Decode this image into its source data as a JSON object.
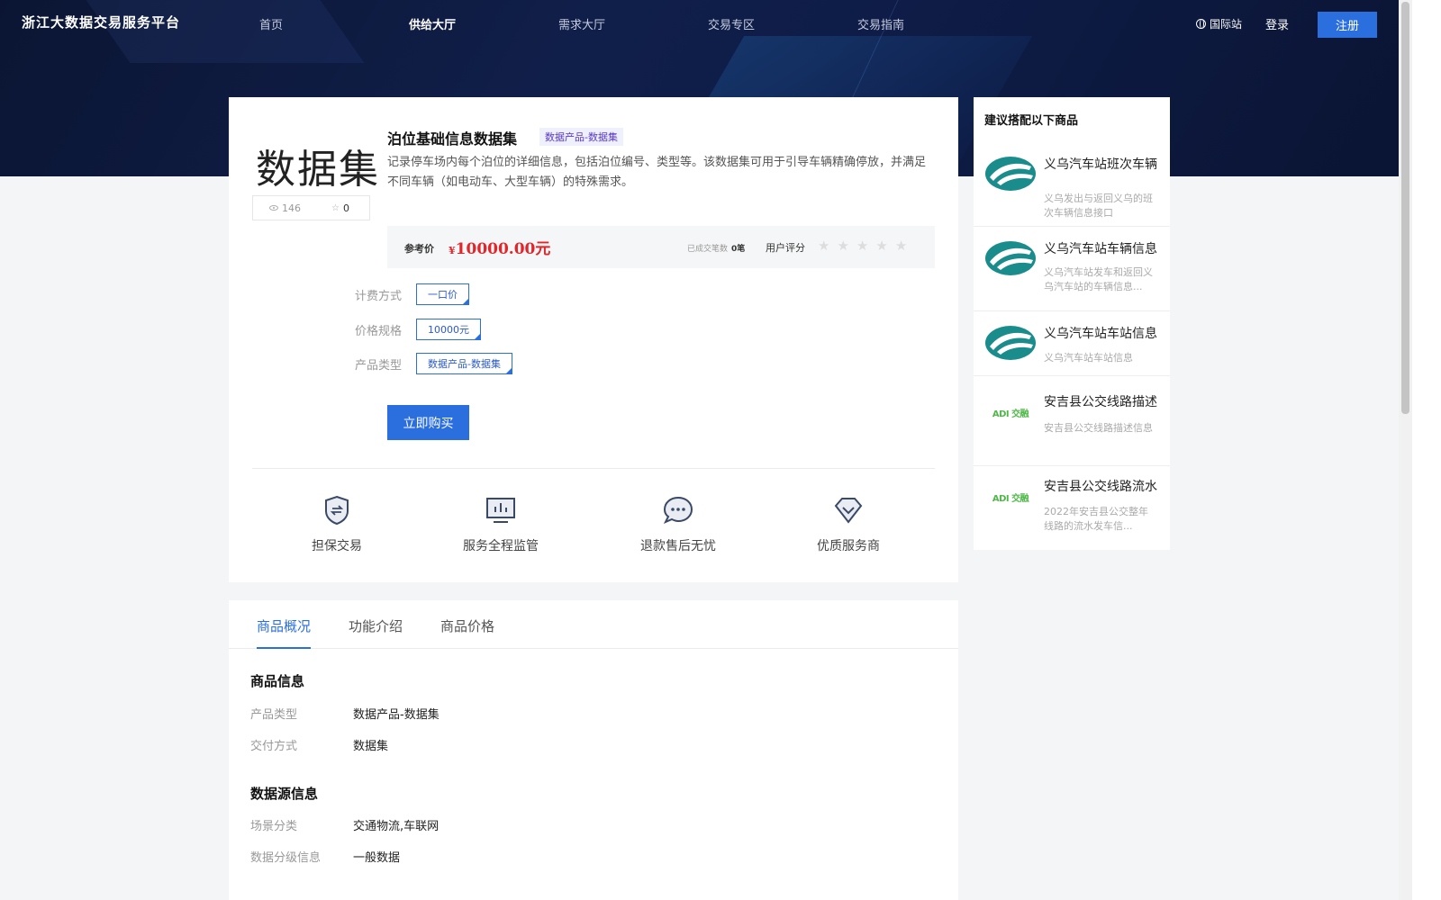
{
  "header": {
    "logo": "浙江大数据交易服务平台",
    "nav": [
      {
        "label": "首页",
        "active": false
      },
      {
        "label": "供给大厅",
        "active": true
      },
      {
        "label": "需求大厅",
        "active": false
      },
      {
        "label": "交易专区",
        "active": false
      },
      {
        "label": "交易指南",
        "active": false
      }
    ],
    "intl": "国际站",
    "login": "登录",
    "register": "注册"
  },
  "product": {
    "cover_text": "数据集",
    "views": "146",
    "favorites": "0",
    "title": "泊位基础信息数据集",
    "tag": "数据产品-数据集",
    "description": "记录停车场内每个泊位的详细信息，包括泊位编号、类型等。该数据集可用于引导车辆精确停放，并满足不同车辆（如电动车、大型车辆）的特殊需求。",
    "price_label": "参考价",
    "price_currency": "¥",
    "price_value": "10000.00元",
    "deals_label": "已成交笔数",
    "deals_value": "0笔",
    "rating_label": "用户评分",
    "rating": 0,
    "rating_max": 5,
    "options": [
      {
        "label": "计费方式",
        "value": "一口价"
      },
      {
        "label": "价格规格",
        "value": "10000元"
      },
      {
        "label": "产品类型",
        "value": "数据产品-数据集"
      }
    ],
    "buy_label": "立即购买"
  },
  "features": [
    {
      "label": "担保交易",
      "icon": "shield-exchange-icon"
    },
    {
      "label": "服务全程监管",
      "icon": "monitor-chart-icon"
    },
    {
      "label": "退款售后无忧",
      "icon": "chat-bubble-icon"
    },
    {
      "label": "优质服务商",
      "icon": "diamond-icon"
    }
  ],
  "tabs": [
    "商品概况",
    "功能介绍",
    "商品价格"
  ],
  "info": {
    "section1_title": "商品信息",
    "section1": [
      {
        "k": "产品类型",
        "v": "数据产品-数据集"
      },
      {
        "k": "交付方式",
        "v": "数据集"
      }
    ],
    "section2_title": "数据源信息",
    "section2": [
      {
        "k": "场景分类",
        "v": "交通物流,车联网"
      },
      {
        "k": "数据分级信息",
        "v": "一般数据"
      }
    ]
  },
  "sidebar": {
    "title": "建议搭配以下商品",
    "items": [
      {
        "name": "义乌汽车站班次车辆",
        "desc": "义乌发出与返回义乌的班次车辆信息接口",
        "logo": "yiwu-bus-logo"
      },
      {
        "name": "义乌汽车站车辆信息",
        "desc": "义乌汽车站发车和返回义乌汽车站的车辆信息...",
        "logo": "yiwu-bus-logo"
      },
      {
        "name": "义乌汽车站车站信息",
        "desc": "义乌汽车站车站信息",
        "logo": "yiwu-bus-logo"
      },
      {
        "name": "安吉县公交线路描述",
        "desc": "安吉县公交线路描述信息",
        "logo": "adi-logo",
        "logo_text": "ADI",
        "logo_text2": "交融"
      },
      {
        "name": "安吉县公交线路流水",
        "desc": "2022年安吉县公交整年线路的流水发车信...",
        "logo": "adi-logo",
        "logo_text": "ADI",
        "logo_text2": "交融"
      }
    ]
  },
  "colors": {
    "accent": "#2b6fdf",
    "price": "#e0262b",
    "hero": "#0e1c47"
  }
}
